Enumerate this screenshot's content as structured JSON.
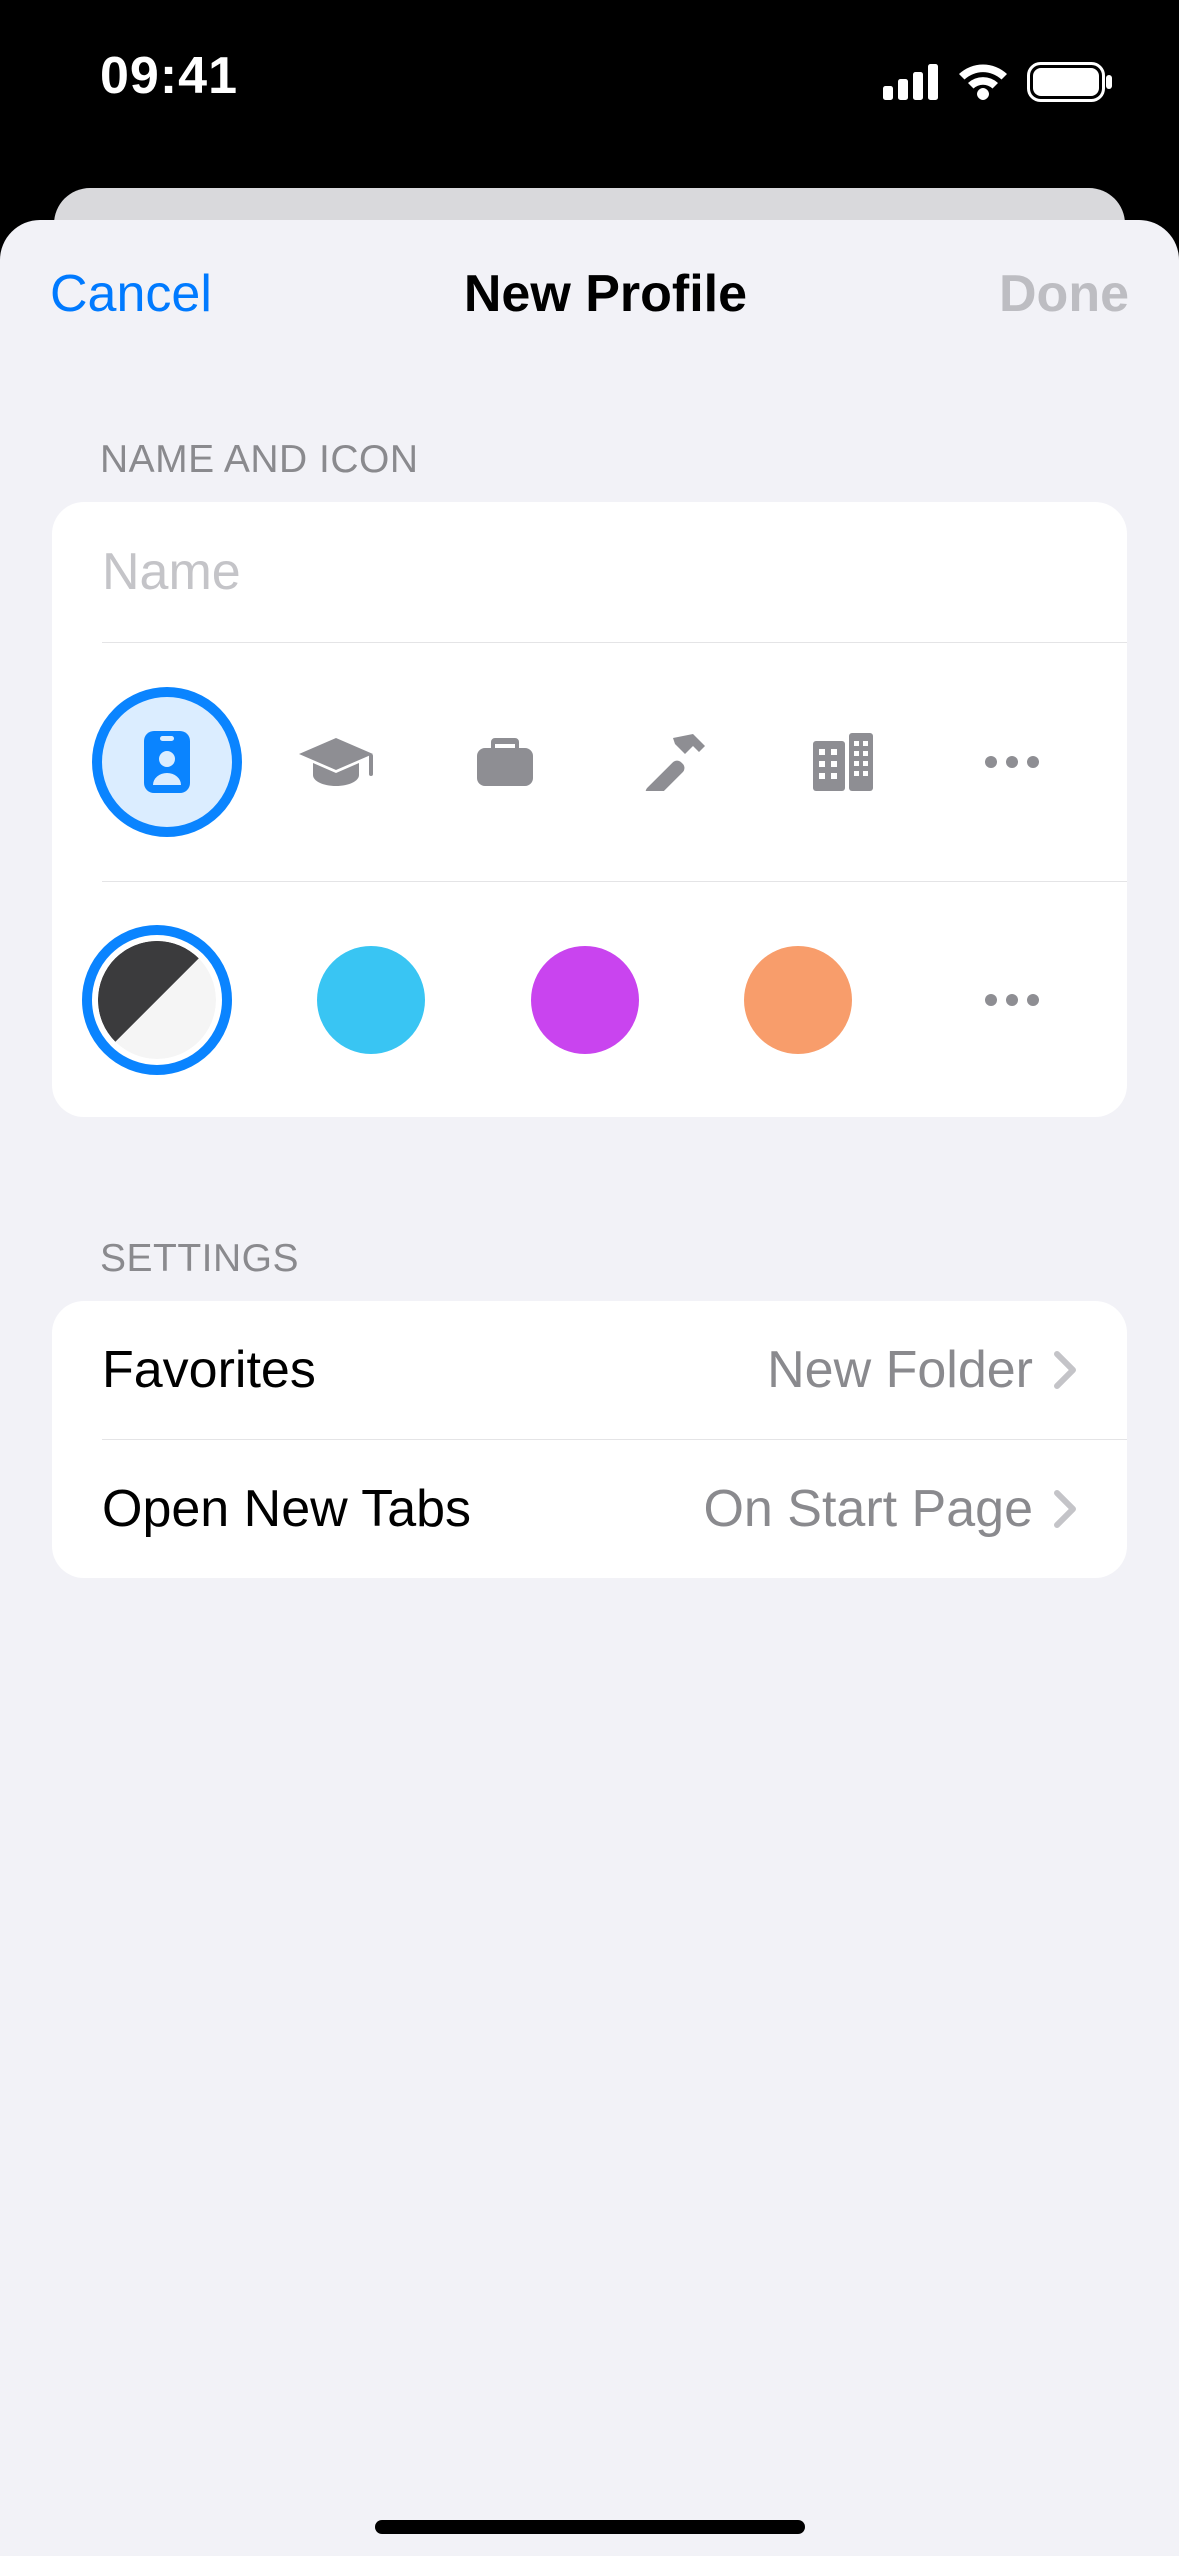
{
  "status": {
    "time": "09:41"
  },
  "header": {
    "cancel": "Cancel",
    "title": "New Profile",
    "done": "Done"
  },
  "sections": {
    "name_icon": "NAME AND ICON",
    "settings": "SETTINGS"
  },
  "profile": {
    "name_value": "",
    "name_placeholder": "Name",
    "icons": [
      {
        "id": "id-card-icon",
        "selected": true
      },
      {
        "id": "graduation-cap-icon",
        "selected": false
      },
      {
        "id": "briefcase-icon",
        "selected": false
      },
      {
        "id": "hammer-icon",
        "selected": false
      },
      {
        "id": "building-icon",
        "selected": false
      },
      {
        "id": "more-icons",
        "selected": false
      }
    ],
    "colors": [
      {
        "id": "auto-bw",
        "hex": "split",
        "selected": true
      },
      {
        "id": "blue",
        "hex": "#39c5f3",
        "selected": false
      },
      {
        "id": "purple",
        "hex": "#c944ef",
        "selected": false
      },
      {
        "id": "orange",
        "hex": "#f89d6b",
        "selected": false
      },
      {
        "id": "more-colors",
        "hex": "",
        "selected": false
      }
    ]
  },
  "settings_rows": {
    "favorites_label": "Favorites",
    "favorites_value": "New Folder",
    "newtabs_label": "Open New Tabs",
    "newtabs_value": "On Start Page"
  }
}
